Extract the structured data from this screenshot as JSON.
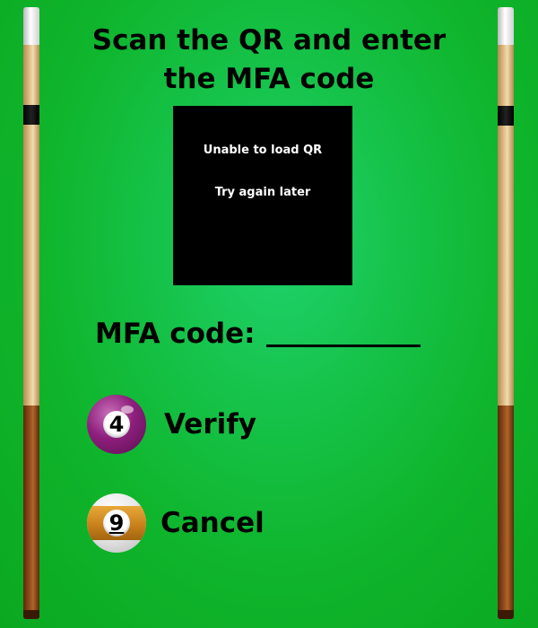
{
  "title": {
    "line1": "Scan the QR and enter",
    "line2": "the MFA code"
  },
  "qr": {
    "error_line1": "Unable to load QR",
    "error_line2": "Try again later"
  },
  "mfa": {
    "label": "MFA code:",
    "value": ""
  },
  "actions": {
    "verify": {
      "label": "Verify",
      "ball_number": "4",
      "ball_color": "#8e1f7d",
      "icon": "pool-ball-4-icon"
    },
    "cancel": {
      "label": "Cancel",
      "ball_number": "9",
      "ball_color": "#c9821c",
      "icon": "pool-ball-9-icon"
    }
  },
  "colors": {
    "table_felt": "#16c34a",
    "text": "#000000",
    "qr_background": "#000000"
  },
  "decorations": {
    "left": "cue-stick-icon",
    "right": "cue-stick-icon"
  }
}
